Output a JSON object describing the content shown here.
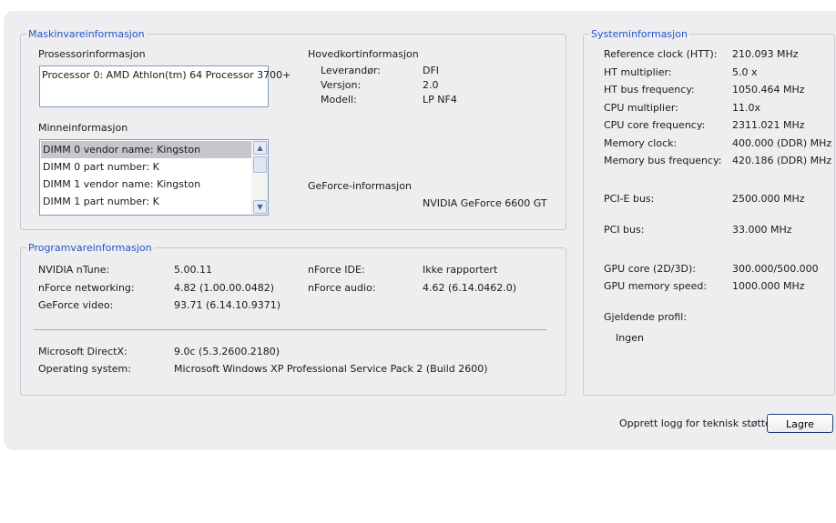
{
  "hardware": {
    "legend": "Maskinvareinformasjon",
    "processor": {
      "label": "Prosessorinformasjon",
      "value": "Processor 0:  AMD Athlon(tm) 64 Processor 3700+"
    },
    "memory": {
      "label": "Minneinformasjon",
      "items": [
        "DIMM 0 vendor name: Kingston",
        "DIMM 0 part number: K",
        "DIMM 1 vendor name: Kingston",
        "DIMM 1 part number: K"
      ]
    },
    "motherboard": {
      "label": "Hovedkortinformasjon",
      "rows": [
        {
          "key": "Leverandør:",
          "value": "DFI"
        },
        {
          "key": "Versjon:",
          "value": "2.0"
        },
        {
          "key": "Modell:",
          "value": "LP NF4"
        }
      ]
    },
    "geforce": {
      "label": "GeForce-informasjon",
      "value": "NVIDIA GeForce 6600 GT"
    }
  },
  "software": {
    "legend": "Programvareinformasjon",
    "left_rows": [
      {
        "key": "NVIDIA nTune:",
        "value": "5.00.11"
      },
      {
        "key": "nForce networking:",
        "value": "4.82 (1.00.00.0482)"
      },
      {
        "key": "GeForce video:",
        "value": "93.71 (6.14.10.9371)"
      }
    ],
    "right_rows": [
      {
        "key": "nForce IDE:",
        "value": "Ikke rapportert"
      },
      {
        "key": "nForce audio:",
        "value": "4.62 (6.14.0462.0)"
      }
    ],
    "bottom_rows": [
      {
        "key": "Microsoft DirectX:",
        "value": "9.0c (5.3.2600.2180)"
      },
      {
        "key": "Operating system:",
        "value": "Microsoft Windows XP Professional Service Pack 2 (Build 2600)"
      }
    ]
  },
  "system": {
    "legend": "Systeminformasjon",
    "rows": [
      {
        "key": "Reference clock (HTT):",
        "value": "210.093  MHz"
      },
      {
        "key": "HT multiplier:",
        "value": "5.0 x"
      },
      {
        "key": "HT bus frequency:",
        "value": "1050.464 MHz"
      },
      {
        "key": "CPU multiplier:",
        "value": "11.0x"
      },
      {
        "key": "CPU core frequency:",
        "value": "2311.021 MHz"
      },
      {
        "key": "Memory clock:",
        "value": "400.000  (DDR) MHz"
      },
      {
        "key": "Memory bus frequency:",
        "value": "420.186  (DDR) MHz"
      },
      {
        "key": "PCI-E bus:",
        "value": "2500.000 MHz"
      },
      {
        "key": "PCI bus:",
        "value": "33.000  MHz"
      },
      {
        "key": "GPU core (2D/3D):",
        "value": "300.000/500.000"
      },
      {
        "key": "GPU memory speed:",
        "value": "1000.000 MHz"
      }
    ],
    "profile_label": "Gjeldende profil:",
    "profile_value": "Ingen"
  },
  "footer": {
    "log_label": "Opprett logg for teknisk støtte:",
    "save_button": "Lagre"
  },
  "icons": {
    "scroll_up": "chevron-up-icon",
    "scroll_down": "chevron-down-icon"
  }
}
